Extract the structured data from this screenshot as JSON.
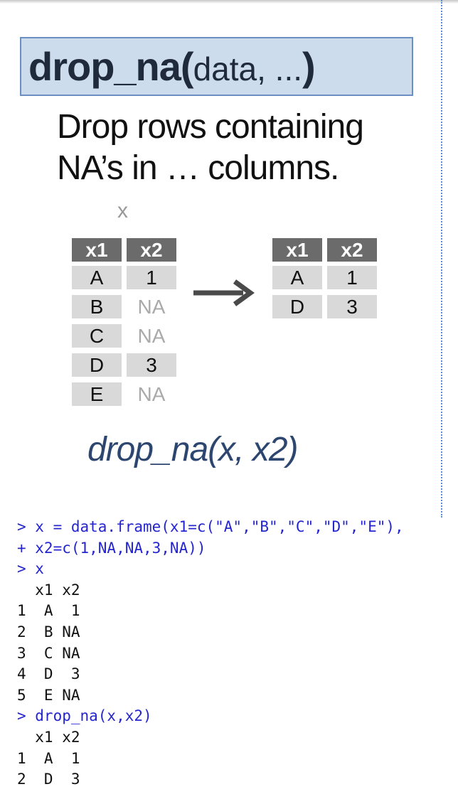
{
  "title": {
    "fn": "drop_na",
    "open": "(",
    "args": "data, ...",
    "close": ")"
  },
  "description": [
    "Drop rows containing",
    "NA’s in … columns."
  ],
  "input_table": {
    "label": "x",
    "headers": [
      "x1",
      "x2"
    ],
    "rows": [
      [
        "A",
        "1"
      ],
      [
        "B",
        "NA"
      ],
      [
        "C",
        "NA"
      ],
      [
        "D",
        "3"
      ],
      [
        "E",
        "NA"
      ]
    ]
  },
  "output_table": {
    "headers": [
      "x1",
      "x2"
    ],
    "rows": [
      [
        "A",
        "1"
      ],
      [
        "D",
        "3"
      ]
    ]
  },
  "example_call": "drop_na(x, x2)",
  "console": [
    {
      "type": "in",
      "text": "> x = data.frame(x1=c(\"A\",\"B\",\"C\",\"D\",\"E\"),"
    },
    {
      "type": "in",
      "text": "+ x2=c(1,NA,NA,3,NA))"
    },
    {
      "type": "in",
      "text": "> x"
    },
    {
      "type": "out",
      "text": "  x1 x2"
    },
    {
      "type": "out",
      "text": "1  A  1"
    },
    {
      "type": "out",
      "text": "2  B NA"
    },
    {
      "type": "out",
      "text": "3  C NA"
    },
    {
      "type": "out",
      "text": "4  D  3"
    },
    {
      "type": "out",
      "text": "5  E NA"
    },
    {
      "type": "in",
      "text": "> drop_na(x,x2)"
    },
    {
      "type": "out",
      "text": "  x1 x2"
    },
    {
      "type": "out",
      "text": "1  A  1"
    },
    {
      "type": "out",
      "text": "2  D  3"
    }
  ]
}
